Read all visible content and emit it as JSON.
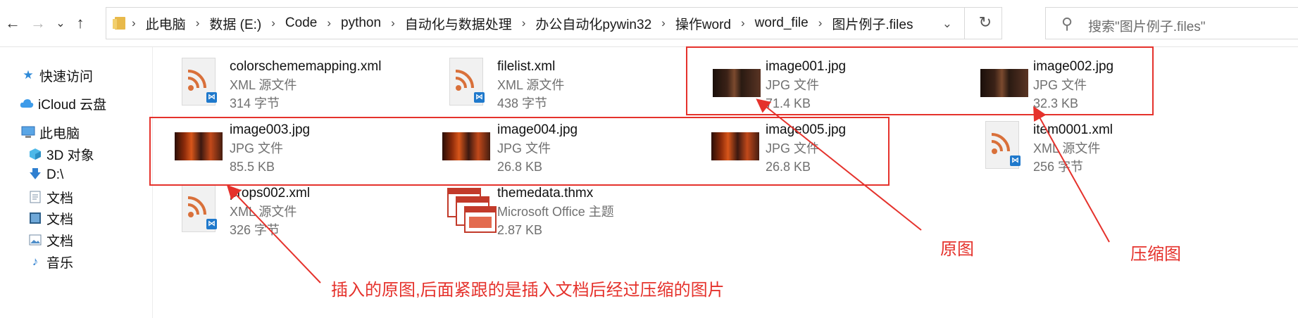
{
  "nav": {
    "back_icon": "arrow-left-icon",
    "forward_icon": "arrow-right-icon",
    "recent_icon": "chevron-down-icon",
    "up_icon": "arrow-up-icon"
  },
  "address": {
    "crumbs": [
      "此电脑",
      "数据 (E:)",
      "Code",
      "python",
      "自动化与数据处理",
      "办公自动化pywin32",
      "操作word",
      "word_file",
      "图片例子.files"
    ]
  },
  "search": {
    "placeholder": "搜索\"图片例子.files\""
  },
  "sidebar": {
    "items": [
      {
        "label": "快速访问",
        "icon": "star-icon"
      },
      {
        "label": "iCloud 云盘",
        "icon": "cloud-icon"
      },
      {
        "label": "此电脑",
        "icon": "computer-icon"
      },
      {
        "label": "3D 对象",
        "icon": "cube-icon"
      },
      {
        "label": "D:\\",
        "icon": "download-icon"
      },
      {
        "label": "文档",
        "icon": "document-icon"
      },
      {
        "label": "文档",
        "icon": "video-icon"
      },
      {
        "label": "文档",
        "icon": "picture-icon"
      },
      {
        "label": "音乐",
        "icon": "music-icon"
      }
    ]
  },
  "files": [
    {
      "name": "colorschememapping.xml",
      "type": "XML 源文件",
      "size": "314 字节",
      "kind": "xml"
    },
    {
      "name": "filelist.xml",
      "type": "XML 源文件",
      "size": "438 字节",
      "kind": "xml"
    },
    {
      "name": "image001.jpg",
      "type": "JPG 文件",
      "size": "71.4 KB",
      "kind": "jpg"
    },
    {
      "name": "image002.jpg",
      "type": "JPG 文件",
      "size": "32.3 KB",
      "kind": "jpg"
    },
    {
      "name": "image003.jpg",
      "type": "JPG 文件",
      "size": "85.5 KB",
      "kind": "jpg2"
    },
    {
      "name": "image004.jpg",
      "type": "JPG 文件",
      "size": "26.8 KB",
      "kind": "jpg2"
    },
    {
      "name": "image005.jpg",
      "type": "JPG 文件",
      "size": "26.8 KB",
      "kind": "jpg2"
    },
    {
      "name": "item0001.xml",
      "type": "XML 源文件",
      "size": "256 字节",
      "kind": "xml"
    },
    {
      "name": "props002.xml",
      "type": "XML 源文件",
      "size": "326 字节",
      "kind": "xml"
    },
    {
      "name": "themedata.thmx",
      "type": "Microsoft Office 主题",
      "size": "2.87 KB",
      "kind": "thmx"
    }
  ],
  "annotations": {
    "original": "原图",
    "compressed": "压缩图",
    "note": "插入的原图,后面紧跟的是插入文档后经过压缩的图片"
  },
  "colors": {
    "annotation": "#e5322c",
    "accent": "#2e8ad8"
  }
}
